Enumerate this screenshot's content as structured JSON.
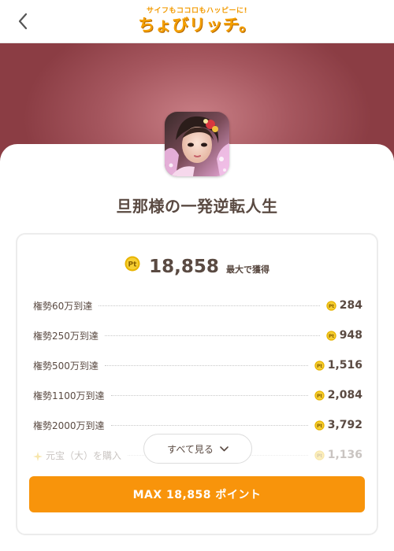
{
  "header": {
    "logo_tagline": "サイフもココロもハッピーに!",
    "logo_main": "ちょびリッチ。"
  },
  "app": {
    "title": "旦那様の一発逆転人生",
    "icon": "game-character-portrait-icon"
  },
  "points": {
    "total": "18,858",
    "total_suffix": "最大で獲得",
    "coin_icon_label": "Pt"
  },
  "rewards": [
    {
      "label": "権勢60万到達",
      "points": "284"
    },
    {
      "label": "権勢250万到達",
      "points": "948"
    },
    {
      "label": "権勢500万到達",
      "points": "1,516"
    },
    {
      "label": "権勢1100万到達",
      "points": "2,084"
    },
    {
      "label": "権勢2000万到達",
      "points": "3,792"
    },
    {
      "label": "元宝（大）を購入",
      "points": "1,136"
    }
  ],
  "see_all": {
    "label": "すべて見る"
  },
  "max_button": {
    "label": "MAX 18,858 ポイント"
  },
  "colors": {
    "accent": "#f8940b",
    "hero": "#a5565e",
    "text": "#5a4a42",
    "coin": "#e8b400"
  }
}
